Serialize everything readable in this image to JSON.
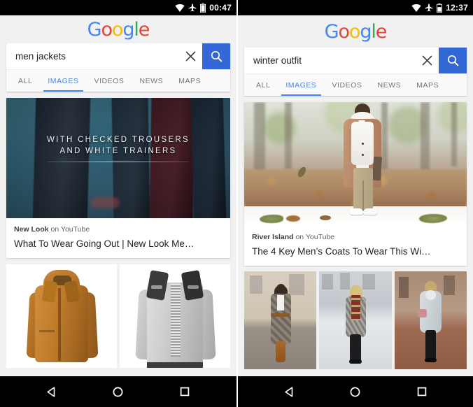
{
  "panels": [
    {
      "id": "left",
      "status": {
        "time": "00:47",
        "wifi_icon": "wifi-icon",
        "airplane_icon": "airplane-mode-icon",
        "battery_icon": "battery-icon"
      },
      "logo": {
        "name": "google-logo",
        "letters": [
          "G",
          "o",
          "o",
          "g",
          "l",
          "e"
        ]
      },
      "search": {
        "value": "men jackets",
        "placeholder": "Search",
        "clear_icon": "clear-x-icon",
        "search_icon": "search-magnifier-icon"
      },
      "tabs": [
        {
          "label": "ALL",
          "active": false
        },
        {
          "label": "IMAGES",
          "active": true
        },
        {
          "label": "VIDEOS",
          "active": false
        },
        {
          "label": "NEWS",
          "active": false
        },
        {
          "label": "MAPS",
          "active": false
        }
      ],
      "video_card": {
        "overlay_line1": "WITH CHECKED TROUSERS",
        "overlay_line2": "AND WHITE TRAINERS",
        "source_name": "New Look",
        "source_suffix": " on YouTube",
        "title": "What To Wear Going Out | New Look Me…"
      },
      "image_grid": [
        {
          "alt": "tan brown mens hooded jacket"
        },
        {
          "alt": "grey mens jacket with black collar"
        }
      ],
      "navbar": {
        "back_icon": "back-triangle-icon",
        "home_icon": "home-circle-icon",
        "recents_icon": "recents-square-icon"
      }
    },
    {
      "id": "right",
      "status": {
        "time": "12:37",
        "wifi_icon": "wifi-icon",
        "airplane_icon": "airplane-mode-icon",
        "battery_icon": "battery-icon"
      },
      "logo": {
        "name": "google-logo",
        "letters": [
          "G",
          "o",
          "o",
          "g",
          "l",
          "e"
        ]
      },
      "search": {
        "value": "winter outfit",
        "placeholder": "Search",
        "clear_icon": "clear-x-icon",
        "search_icon": "search-magnifier-icon"
      },
      "tabs": [
        {
          "label": "ALL",
          "active": false
        },
        {
          "label": "IMAGES",
          "active": true
        },
        {
          "label": "VIDEOS",
          "active": false
        },
        {
          "label": "NEWS",
          "active": false
        },
        {
          "label": "MAPS",
          "active": false
        }
      ],
      "video_card": {
        "overlay_line1": "",
        "overlay_line2": "",
        "source_name": "River Island",
        "source_suffix": " on YouTube",
        "title": "The 4 Key Men’s Coats To Wear This Wi…"
      },
      "image_grid": [
        {
          "alt": "woman in plaid long coat and tan boots"
        },
        {
          "alt": "woman in grey coat with patterned scarf in snow"
        },
        {
          "alt": "woman in light grey coat with pink bag"
        }
      ],
      "navbar": {
        "back_icon": "back-triangle-icon",
        "home_icon": "home-circle-icon",
        "recents_icon": "recents-square-icon"
      }
    }
  ],
  "colors": {
    "google_blue": "#4285F4",
    "search_button_blue": "#3367d6",
    "google_red": "#EA4335",
    "google_yellow": "#FBBC05",
    "google_green": "#34A853",
    "page_background": "#f1f1f1",
    "card_white": "#ffffff",
    "status_bar_black": "#000000",
    "tab_inactive_grey": "#70757a"
  }
}
